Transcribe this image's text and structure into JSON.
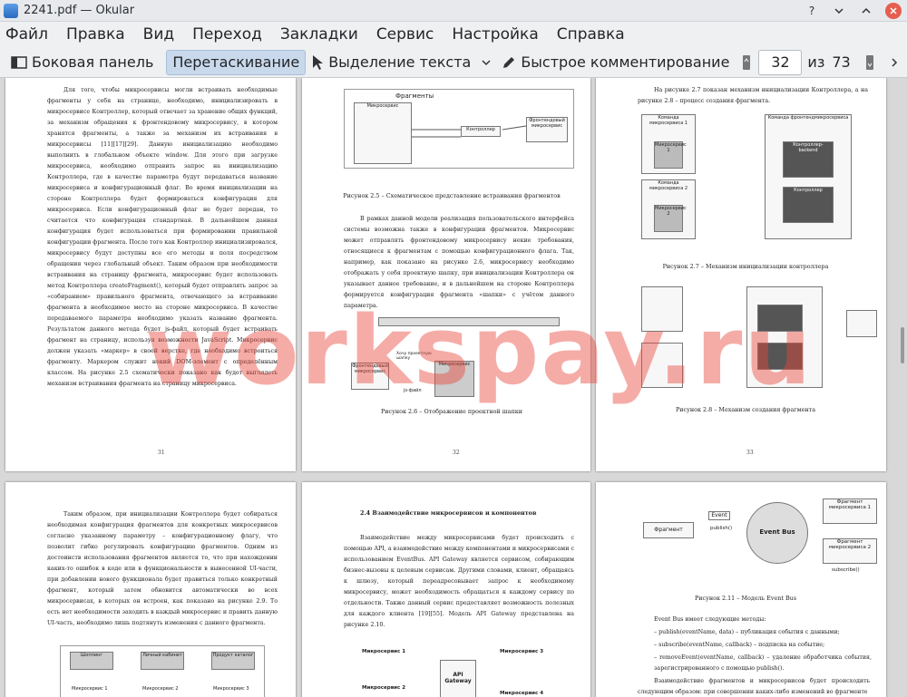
{
  "window": {
    "title": "2241.pdf — Okular"
  },
  "menu": [
    "Файл",
    "Правка",
    "Вид",
    "Переход",
    "Закладки",
    "Сервис",
    "Настройка",
    "Справка"
  ],
  "toolbar": {
    "sidebar": "Боковая панель",
    "drag": "Перетаскивание",
    "select_text": "Выделение текста",
    "quick_annot": "Быстрое комментирование",
    "page_current": "32",
    "page_of": "из",
    "page_total": "73"
  },
  "watermark": "workspay.ru",
  "pages": {
    "p31": {
      "num": "31",
      "text": "Для того, чтобы микросервисы могли встраивать необходимые фрагменты у себя на странице, необходимо, инициализировать в микросервисе Контроллер, который отвечает за хранение общих функций, за механизм обращения к фронтендовому микросервису, в котором хранятся фрагменты, а также за механизм их встраивания в микросервисы [11][17][29]. Данную инициализацию необходимо выполнить в глобальном объекте window. Для этого при загрузке микросервиса, необходимо отправить запрос на инициализацию Контроллера, где в качестве параметра будут передаваться название микросервиса и конфигурационный флаг. Во время инициализации на стороне Контроллера будет формироваться конфигурация для микросервиса. Если конфигурационный флаг не будет передан, то считается что конфигурация стандартная. В дальнейшем данная конфигурация будет использоваться при формировании правильной конфигурации фрагмента. После того как Контроллер инициализировался, микросервису будут доступны все его методы и поля посредством обращения через глобальный объект. Таким образом при необходимости встраивания на страницу фрагмента, микросервис будет использовать метод Контроллера createFragment(), который будет отправлять запрос за «собиранием» правильного фрагмента, отвечающего за встраивание фрагмента в необходимое место на стороне микросервиса. В качестве передаваемого параметра необходимо указать название фрагмента. Результатом данного метода будет js-файл, который будет встраивать фрагмент на страницу, используя возможности JavaScript. Микросервис должен указать «маркер» в своей верстке, где необходимо встроиться фрагменту. Маркером служит некий DOM-элемент с определённым классом. На рисунке 2.5 схематически показано как будет выглядеть механизм встраивания фрагмента на страницу микросервиса."
    },
    "p32": {
      "num": "32",
      "fig_title": "Фрагменты",
      "fig_ms": "Микросервис",
      "fig_ctrl": "Контроллер",
      "fig_front": "Фронтендовый микросервис",
      "cap1": "Рисунок 2.5 – Схематическое представление встраивания фрагментов",
      "text": "В рамках данной модели реализация пользовательского интерфейса системы возможна также в конфигурации фрагментов. Микросервис может отправлять фронтендовому микросервису некие требования, относящиеся к фрагментам с помощью конфигурационного флага. Так, например, как показано на рисунке 2.6, микросервису необходимо отображать у себя проектную шапку, при инициализации Контроллера он указывает данное требование, и в дальнейшем на стороне Контроллера формируется конфигурация фрагмента «шапки» с учётом данного параметра.",
      "fig2_front": "Фронтендовый микросервис",
      "fig2_ms": "Микросервис",
      "fig2_label": "Хочу проектную шапку",
      "fig2_js": "js-файл",
      "cap2": "Рисунок 2.6 – Отображение проектной шапки"
    },
    "p33": {
      "num": "33",
      "text": "На рисунке 2.7 показан механизм инициализации Контроллера, а на рисунке 2.8 – процесс создания фрагмента.",
      "cmd1": "Команда микросервиса 1",
      "cmd2": "Команда микросервиса 2",
      "cmdf": "Команда фронтендмикросервиса",
      "ms1": "Микросервис 1",
      "ms2": "Микросервис 2",
      "ctrl_backend": "Контроллер-backend",
      "ctrl": "Контроллер",
      "cap1": "Рисунок 2.7 – Механизм инициализации контроллера",
      "cap2": "Рисунок 2.8 – Механизм создания фрагмента"
    },
    "p34": {
      "text": "Таким образом, при инициализации Контроллера будет собираться необходимая конфигурация фрагментов для конкретных микросервисов согласно указанному параметру – конфигурационному флагу, что позволит гибко регулировать конфигурацию фрагментов. Одним из достоинств использования фрагментов является то, что при нахождении каких-то ошибок в коде или в функциональности в вынесенной UI-части, при добавлении нового функционала будет правиться только конкретный фрагмент, который затем обновится автоматически во всех микросервисах, в которых он встроен, как показано на рисунке 2.9. То есть нет необходимости заходить в каждый микросервис и править данную UI-часть, необходимо лишь подтянуть изменения с данного фрагмента.",
      "fig": [
        "Шоппинг",
        "Личный кабинет",
        "Продукт каталог"
      ],
      "figms": [
        "Микросервис 1",
        "Микросервис 2",
        "Микросервис 3"
      ]
    },
    "p35": {
      "heading": "2.4 Взаимодействие микросервисов и компонентов",
      "text": "Взаимодействие между микросервисами будет происходить с помощью API, а взаимодействие между компонентами и микросервисами с использованием EventBus. API Gateway является сервисом, собирающим бизнес-вызовы к целевым сервисам. Другими словами, клиент, обращаясь к шлюзу, который переадресовывает запрос к необходимому микросервису, может необходимость обращаться к каждому сервису по отдельности. Также данный сервис предоставляет возможность полезных для каждого клиента [19][55]. Модель API Gateway представлена на рисунке 2.10.",
      "ms1": "Микросервис 1",
      "ms2": "Микросервис 2",
      "ms3": "Микросервис 3",
      "ms4": "Микросервис 4",
      "gw": "API Gateway"
    },
    "p36": {
      "frag": "Фрагмент",
      "event": "Event",
      "publish": "publish()",
      "bus": "Event Bus",
      "fms1": "Фрагмент микросервиса 1",
      "fms2": "Фрагмент микросервиса 2",
      "subscribe": "subscribe()",
      "cap": "Рисунок 2.11 – Модель Event Bus",
      "t1": "Event Bus имеет следующие методы:",
      "t2": "– publish(eventName, data) – публикация события с данными;",
      "t3": "– subscribe(eventName, callback) – подписка на событие;",
      "t4": "– removeEvent(eventName, callback) – удаление обработчика события, зарегистрированного с помощью publish().",
      "t5": "Взаимодействие фрагментов и микросервисов будет происходить следующим образом: при совершении каких-либо изменений во фрагменте"
    }
  }
}
